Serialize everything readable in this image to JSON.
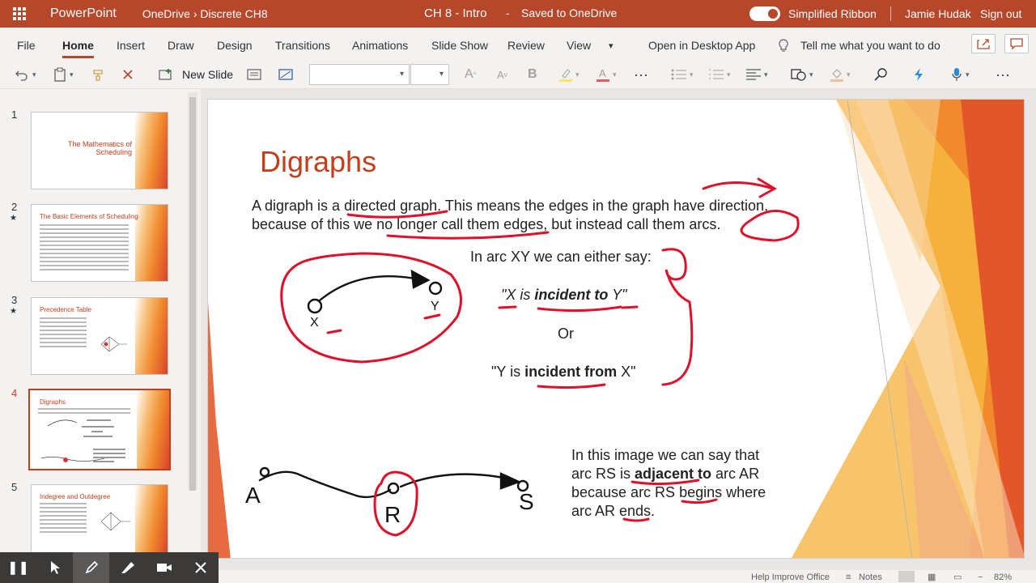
{
  "titlebar": {
    "app_name": "PowerPoint",
    "breadcrumb": "OneDrive › Discrete CH8",
    "doc_title": "CH 8 - Intro",
    "save_status": "Saved to OneDrive",
    "ribbon_toggle": "Simplified Ribbon",
    "user": "Jamie Hudak",
    "sign_out": "Sign out",
    "accent": "#b7472a"
  },
  "tabs": {
    "file": "File",
    "home": "Home",
    "insert": "Insert",
    "draw": "Draw",
    "design": "Design",
    "transitions": "Transitions",
    "animations": "Animations",
    "slideshow": "Slide Show",
    "review": "Review",
    "view": "View",
    "desktop": "Open in Desktop App",
    "tellme": "Tell me what you want to do"
  },
  "toolbar": {
    "new_slide": "New Slide",
    "icons": [
      "undo-icon",
      "clipboard-icon",
      "format-painter-icon",
      "cut-icon",
      "layout-icon",
      "section-icon",
      "font-grow-icon",
      "font-shrink-icon",
      "bold-icon",
      "highlight-icon",
      "font-color-icon",
      "more-icon",
      "bullets-icon",
      "numbering-icon",
      "align-icon",
      "shapes-icon",
      "fill-icon",
      "find-icon",
      "designer-icon",
      "dictate-icon",
      "more-icon"
    ]
  },
  "thumbnails": [
    {
      "num": "1",
      "title": "The Mathematics of Scheduling",
      "star": false
    },
    {
      "num": "2",
      "title": "The Basic Elements of Scheduling",
      "star": true
    },
    {
      "num": "3",
      "title": "Precedence Table",
      "star": true
    },
    {
      "num": "4",
      "title": "Digraphs",
      "star": false
    },
    {
      "num": "5",
      "title": "Indegree and Outdegree",
      "star": false
    }
  ],
  "slide": {
    "title": "Digraphs",
    "para1": "A digraph is a directed graph. This means the edges in the graph have direction, because of this we no longer call them edges, but instead call them arcs.",
    "arc_intro": "In arc XY we can either say:",
    "quote1_pre": "\"X is ",
    "quote1_bold": "incident to",
    "quote1_post": " Y\"",
    "or": "Or",
    "quote2_pre": "\"Y is ",
    "quote2_bold": "incident from",
    "quote2_post": " X\"",
    "img_line1": "In this image we can say that",
    "img_line2_pre": "arc RS is ",
    "img_line2_bold": "adjacent to",
    "img_line2_post": " arc AR",
    "img_line3": "because arc RS begins where",
    "img_line4": "arc AR ends.",
    "node_x": "X",
    "node_y": "Y",
    "node_a": "A",
    "node_r": "R",
    "node_s": "S",
    "theme_colors": [
      "#c43e1c",
      "#f18a2d",
      "#f6b13d",
      "#e55a2b"
    ],
    "ink_color": "#e0102a"
  },
  "status": {
    "help": "Help Improve Office",
    "notes": "Notes",
    "zoom": "82%"
  }
}
